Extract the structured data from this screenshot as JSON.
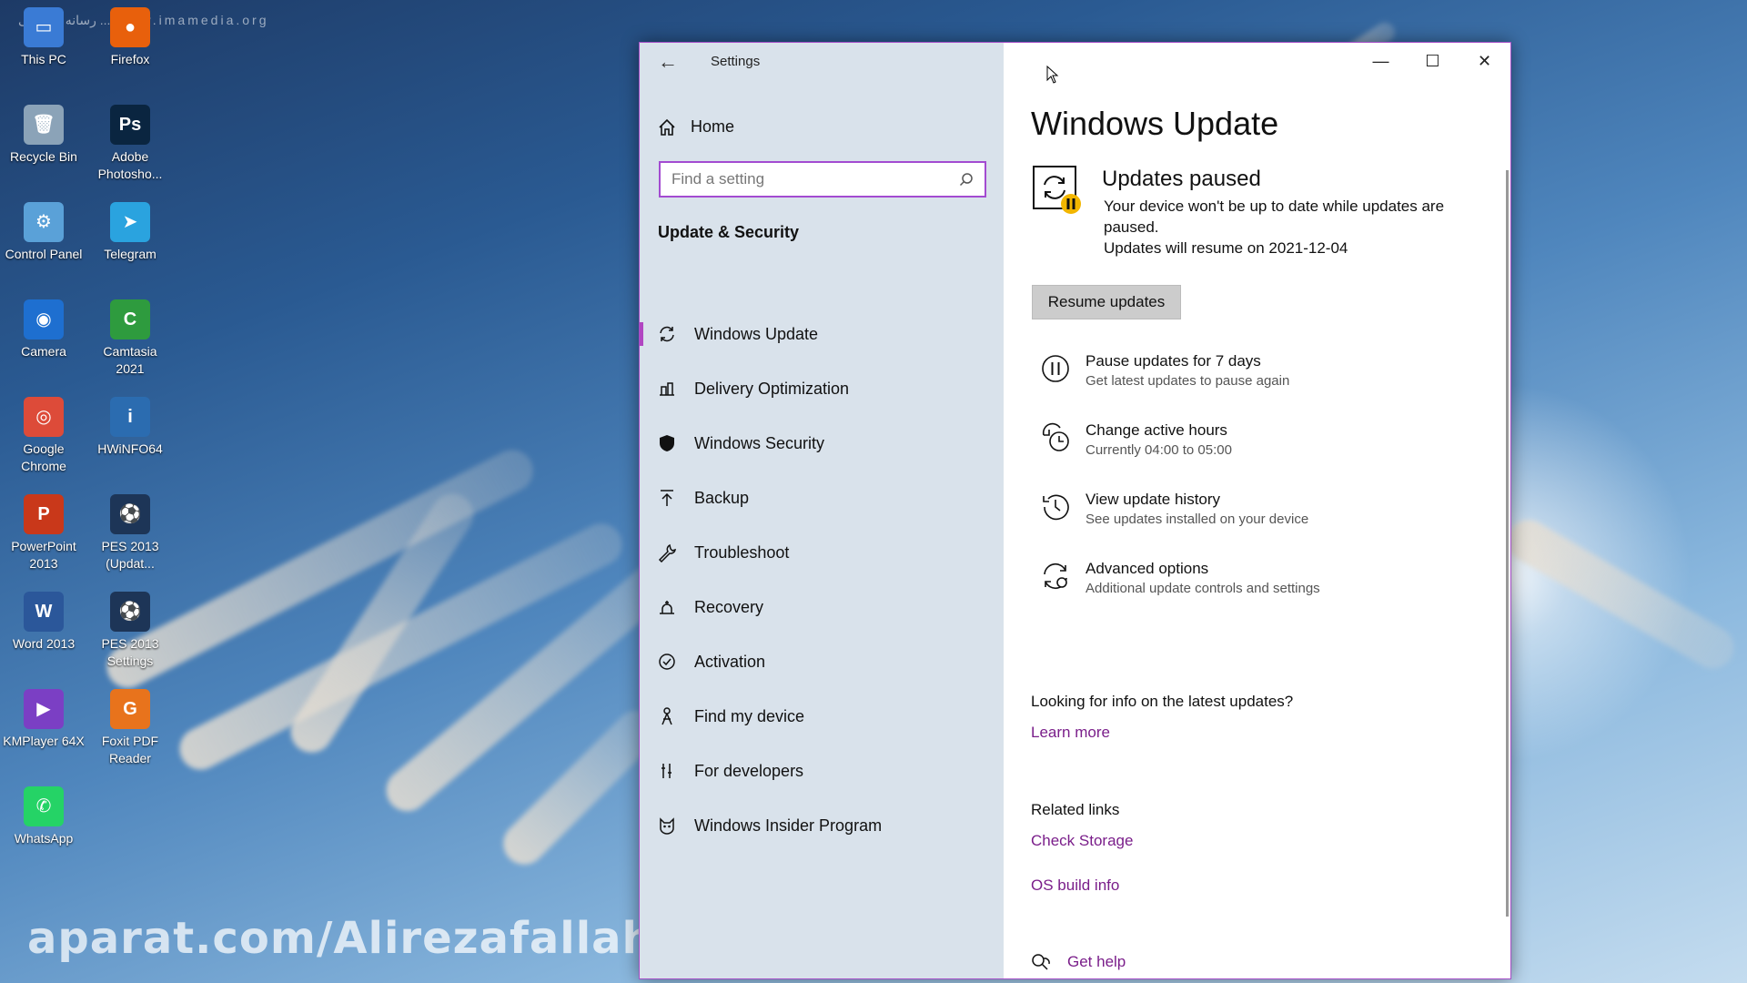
{
  "desktop": {
    "top_watermark": "رسانه دیجیتالی ....  www.imamedia.org",
    "bottom_watermark": "aparat.com/Alirezafallahomidvar",
    "icons": [
      {
        "label": "This PC",
        "icon": "this-pc-icon",
        "color": "#3a7bd5",
        "glyph": "▭"
      },
      {
        "label": "Firefox",
        "icon": "firefox-icon",
        "color": "#e8600c",
        "glyph": "●"
      },
      {
        "label": "Recycle Bin",
        "icon": "recycle-bin-icon",
        "color": "#8ba3b8",
        "glyph": "🗑"
      },
      {
        "label": "Adobe Photosho...",
        "icon": "photoshop-icon",
        "color": "#0a2540",
        "glyph": "Ps"
      },
      {
        "label": "Control Panel",
        "icon": "control-panel-icon",
        "color": "#5aa1d8",
        "glyph": "⚙"
      },
      {
        "label": "Telegram",
        "icon": "telegram-icon",
        "color": "#2aa3df",
        "glyph": "➤"
      },
      {
        "label": "Camera",
        "icon": "camera-icon",
        "color": "#1e6fd0",
        "glyph": "◉"
      },
      {
        "label": "Camtasia 2021",
        "icon": "camtasia-icon",
        "color": "#2e9b3e",
        "glyph": "C"
      },
      {
        "label": "Google Chrome",
        "icon": "chrome-icon",
        "color": "#dd4b39",
        "glyph": "◎"
      },
      {
        "label": "HWiNFO64",
        "icon": "hwinfo-icon",
        "color": "#2b6cb0",
        "glyph": "i"
      },
      {
        "label": "PowerPoint 2013",
        "icon": "powerpoint-icon",
        "color": "#c9381a",
        "glyph": "P"
      },
      {
        "label": "PES 2013 (Updat...",
        "icon": "pes-update-icon",
        "color": "#1d3557",
        "glyph": "⚽"
      },
      {
        "label": "Word 2013",
        "icon": "word-icon",
        "color": "#2b579a",
        "glyph": "W"
      },
      {
        "label": "PES 2013 Settings",
        "icon": "pes-settings-icon",
        "color": "#1d3557",
        "glyph": "⚽"
      },
      {
        "label": "KMPlayer 64X",
        "icon": "kmplayer-icon",
        "color": "#7b3fc4",
        "glyph": "▶"
      },
      {
        "label": "Foxit PDF Reader",
        "icon": "foxit-icon",
        "color": "#e8731c",
        "glyph": "G"
      },
      {
        "label": "WhatsApp",
        "icon": "whatsapp-icon",
        "color": "#25d366",
        "glyph": "✆"
      }
    ]
  },
  "window": {
    "title": "Settings",
    "home_label": "Home",
    "search_placeholder": "Find a setting",
    "section_title": "Update & Security",
    "nav": [
      {
        "label": "Windows Update",
        "icon": "refresh-icon"
      },
      {
        "label": "Delivery Optimization",
        "icon": "delivery-icon"
      },
      {
        "label": "Windows Security",
        "icon": "shield-icon"
      },
      {
        "label": "Backup",
        "icon": "backup-icon"
      },
      {
        "label": "Troubleshoot",
        "icon": "wrench-icon"
      },
      {
        "label": "Recovery",
        "icon": "recovery-icon"
      },
      {
        "label": "Activation",
        "icon": "check-circle-icon"
      },
      {
        "label": "Find my device",
        "icon": "person-icon"
      },
      {
        "label": "For developers",
        "icon": "developer-icon"
      },
      {
        "label": "Windows Insider Program",
        "icon": "insider-icon"
      }
    ],
    "active_nav": "Windows Update",
    "accent_color": "#b146c2"
  },
  "content": {
    "heading": "Windows Update",
    "status_title": "Updates paused",
    "status_desc": "Your device won't be up to date while updates are paused.",
    "status_resume": "Updates will resume on 2021-12-04",
    "resume_button": "Resume updates",
    "options": [
      {
        "title": "Pause updates for 7 days",
        "subtitle": "Get latest updates to pause again",
        "icon": "pause-icon"
      },
      {
        "title": "Change active hours",
        "subtitle": "Currently 04:00 to 05:00",
        "icon": "clock-icon"
      },
      {
        "title": "View update history",
        "subtitle": "See updates installed on your device",
        "icon": "history-icon"
      },
      {
        "title": "Advanced options",
        "subtitle": "Additional update controls and settings",
        "icon": "advanced-settings-icon"
      }
    ],
    "info_question": "Looking for info on the latest updates?",
    "learn_more": "Learn more",
    "related_links_title": "Related links",
    "check_storage": "Check Storage",
    "os_build_info": "OS build info",
    "get_help": "Get help",
    "link_color": "#7a1e8a"
  }
}
